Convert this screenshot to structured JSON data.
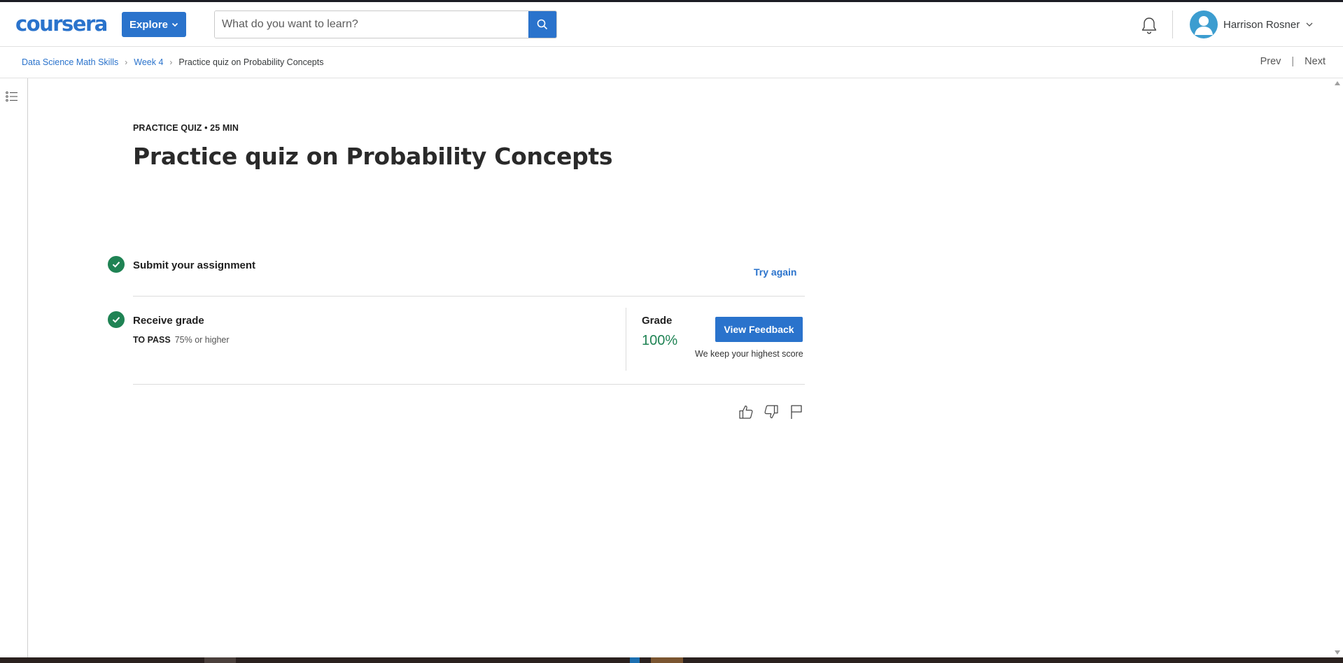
{
  "header": {
    "logo": "coursera",
    "explore_label": "Explore",
    "search_placeholder": "What do you want to learn?",
    "user_name": "Harrison Rosner"
  },
  "breadcrumb": {
    "items": [
      "Data Science Math Skills",
      "Week 4"
    ],
    "current": "Practice quiz on Probability Concepts"
  },
  "nav": {
    "prev": "Prev",
    "separator": "|",
    "next": "Next"
  },
  "main": {
    "eyebrow": "PRACTICE QUIZ • 25 MIN",
    "title": "Practice quiz on Probability Concepts",
    "submit_step": "Submit your assignment",
    "try_again": "Try again",
    "receive_step": "Receive grade",
    "to_pass_label": "TO PASS",
    "to_pass_value": "75% or higher",
    "grade_label": "Grade",
    "grade_value": "100%",
    "view_feedback": "View Feedback",
    "highest_note": "We keep your highest score"
  },
  "icons": [
    "search-icon",
    "bell-icon",
    "avatar-icon",
    "chevron-down-icon",
    "list-icon",
    "check-icon",
    "thumbs-up-icon",
    "thumbs-down-icon",
    "flag-icon"
  ],
  "colors": {
    "brand_blue": "#2a73cc",
    "success_green": "#1f8354"
  }
}
